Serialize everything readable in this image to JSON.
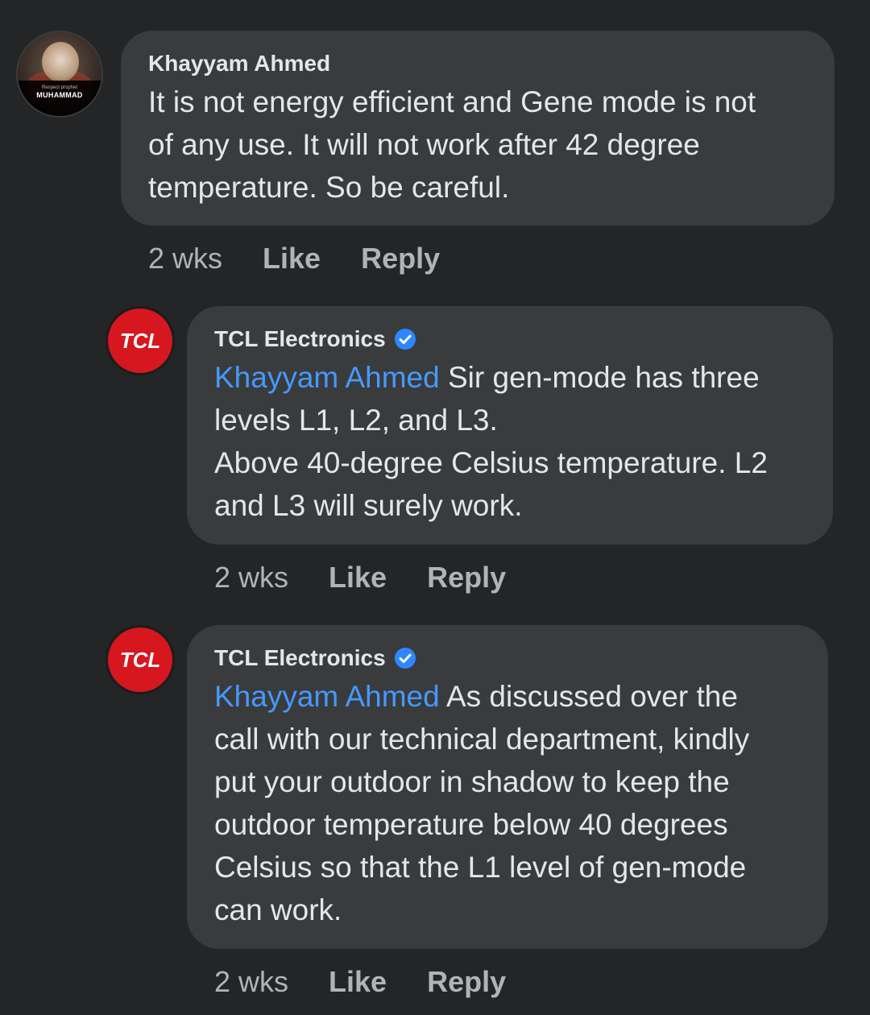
{
  "comments": [
    {
      "author": "Khayyam Ahmed",
      "verified": false,
      "avatar": {
        "type": "photo",
        "banner_small": "Respect prophet",
        "banner_text": "MUHAMMAD"
      },
      "mention": "",
      "text": "It is not energy efficient and Gene mode is not\nof any use. It will not work after 42 degree\ntemperature. So be careful.",
      "time": "2 wks",
      "like_label": "Like",
      "reply_label": "Reply"
    },
    {
      "author": "TCL Electronics",
      "verified": true,
      "avatar": {
        "type": "logo",
        "logo_text": "TCL"
      },
      "mention": "Khayyam Ahmed",
      "text": " Sir gen-mode has three\nlevels L1, L2, and L3.\nAbove 40-degree Celsius temperature. L2\nand L3 will surely work.",
      "time": "2 wks",
      "like_label": "Like",
      "reply_label": "Reply"
    },
    {
      "author": "TCL Electronics",
      "verified": true,
      "avatar": {
        "type": "logo",
        "logo_text": "TCL"
      },
      "mention": "Khayyam Ahmed",
      "text": " As discussed over the\ncall with our technical department, kindly\nput your outdoor in shadow to keep the\noutdoor temperature below 40 degrees\nCelsius so that the L1 level of gen-mode\ncan work.",
      "time": "2 wks",
      "like_label": "Like",
      "reply_label": "Reply"
    }
  ],
  "colors": {
    "background": "#242526",
    "bubble": "#3a3b3c",
    "mention": "#4599ff",
    "verified_badge": "#2d88ff",
    "tcl_red": "#d6171f",
    "secondary_text": "#b0b3b8"
  }
}
